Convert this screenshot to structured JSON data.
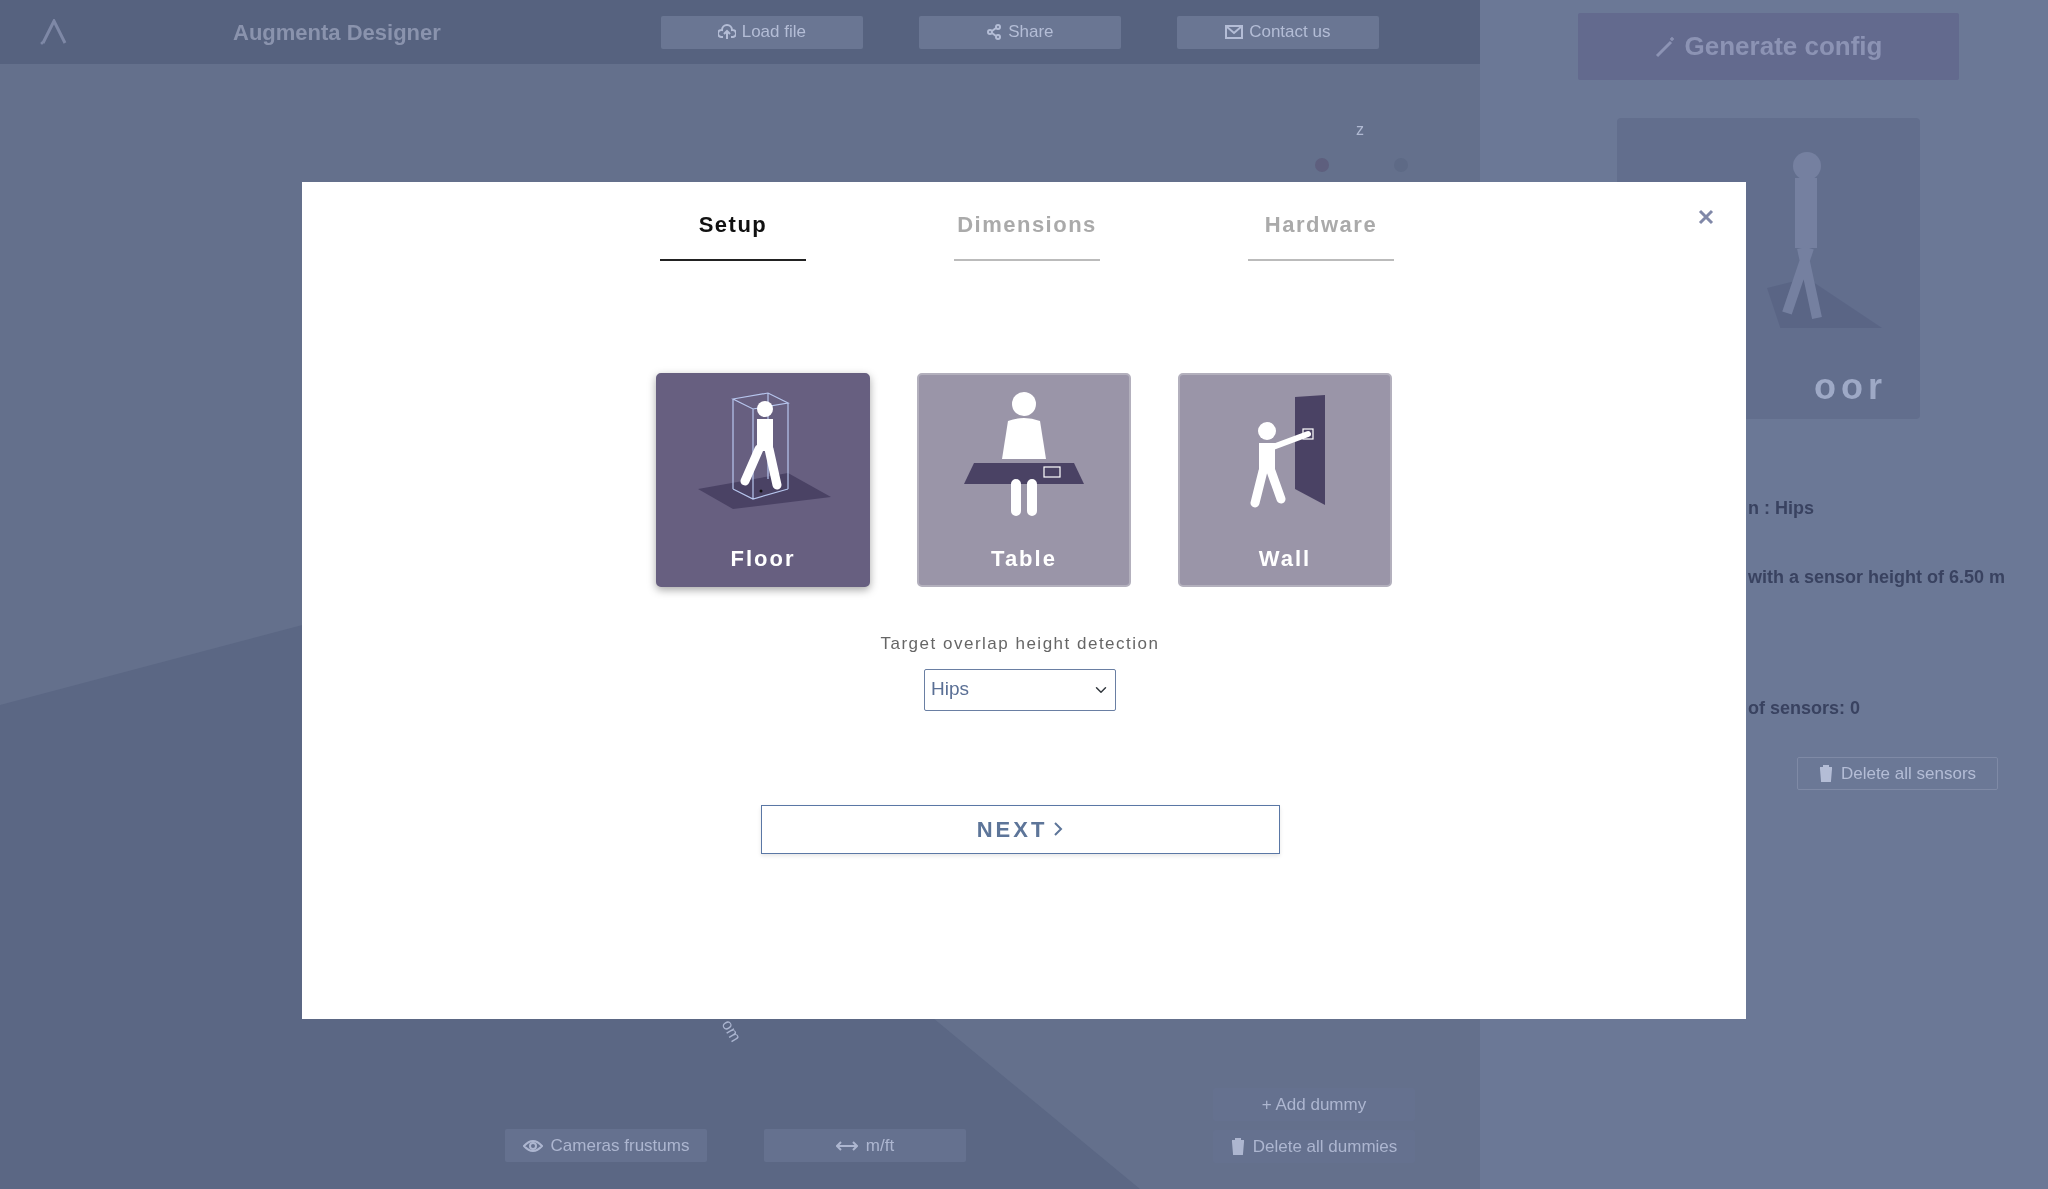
{
  "app": {
    "title": "Augmenta Designer",
    "toolbar": [
      {
        "label": "Load file"
      },
      {
        "label": "Share"
      },
      {
        "label": "Contact us"
      }
    ]
  },
  "viewport": {
    "axis_label": "z",
    "ruler_label": "om",
    "buttons": [
      {
        "label": "Cameras frustums"
      },
      {
        "label": "m/ft"
      }
    ],
    "dummy_buttons": [
      {
        "label": "+ Add dummy"
      },
      {
        "label": "Delete all dummies"
      }
    ]
  },
  "side_panel": {
    "generate_button": "Generate config",
    "preview_label": "oor",
    "lines": [
      "n : Hips",
      "with a sensor height of 6.50 m",
      "of sensors: 0"
    ],
    "delete_button": "Delete all sensors"
  },
  "dialog": {
    "tabs": [
      {
        "label": "Setup",
        "selected": true
      },
      {
        "label": "Dimensions",
        "selected": false
      },
      {
        "label": "Hardware",
        "selected": false
      }
    ],
    "modes": [
      {
        "kind": "floor",
        "label": "Floor",
        "selected": true
      },
      {
        "kind": "table",
        "label": "Table",
        "selected": false
      },
      {
        "kind": "wall",
        "label": "Wall",
        "selected": false
      }
    ],
    "select": {
      "label": "Target overlap height detection",
      "value": "Hips"
    },
    "next_button": "NEXT"
  }
}
